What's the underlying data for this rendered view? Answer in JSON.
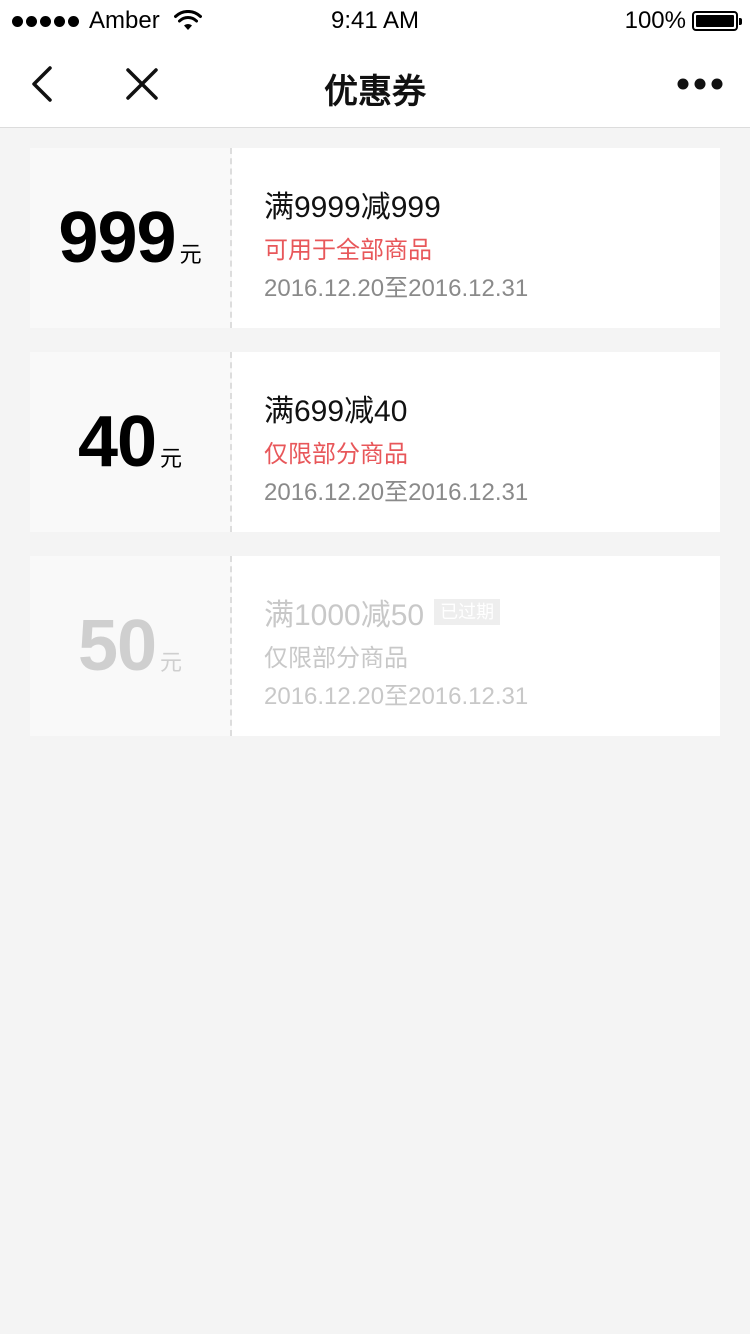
{
  "status_bar": {
    "carrier": "Amber",
    "time": "9:41 AM",
    "battery_percent": "100%",
    "battery_level": 1.0
  },
  "nav": {
    "title": "优惠券",
    "back_icon": "chevron-left-icon",
    "close_icon": "close-icon",
    "more_icon": "more-dots-icon"
  },
  "coupons": [
    {
      "amount": "999",
      "unit": "元",
      "title": "满9999减999",
      "scope": "可用于全部商品",
      "date_range": "2016.12.20至2016.12.31",
      "expired": false
    },
    {
      "amount": "40",
      "unit": "元",
      "title": "满699减40",
      "scope": "仅限部分商品",
      "date_range": "2016.12.20至2016.12.31",
      "expired": false
    },
    {
      "amount": "50",
      "unit": "元",
      "title": "满1000减50",
      "badge": "已过期",
      "scope": "仅限部分商品",
      "date_range": "2016.12.20至2016.12.31",
      "expired": true
    }
  ],
  "colors": {
    "accent_red": "#e8575a",
    "background": "#f4f4f4",
    "date_gray": "#8a8a8a",
    "expired_gray": "#c8c8c8"
  }
}
